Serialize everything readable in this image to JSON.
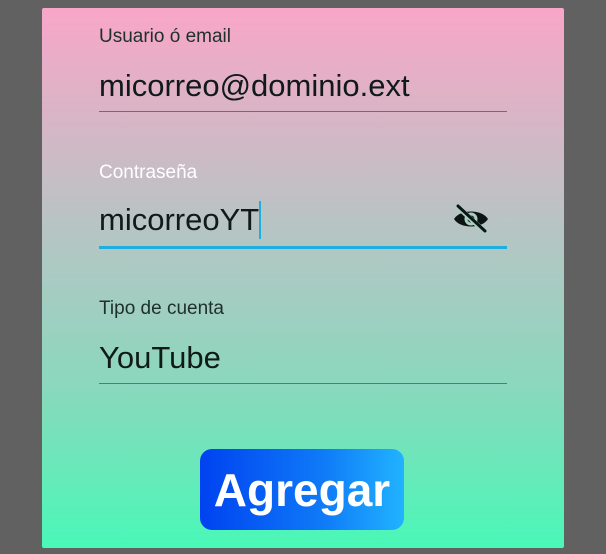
{
  "form": {
    "username": {
      "label": "Usuario ó email",
      "value": "micorreo@dominio.ext"
    },
    "password": {
      "label": "Contraseña",
      "value": "micorreoYT",
      "toggle_icon": "eye-off-icon"
    },
    "account_type": {
      "label": "Tipo de cuenta",
      "value": "YouTube"
    },
    "submit_label": "Agregar"
  },
  "colors": {
    "background": "#616161",
    "gradient_top": "#f9a6c8",
    "gradient_bottom": "#49f8b7",
    "focus_accent": "#1faee0",
    "button_start": "#0042f0",
    "button_end": "#21b3ff"
  }
}
